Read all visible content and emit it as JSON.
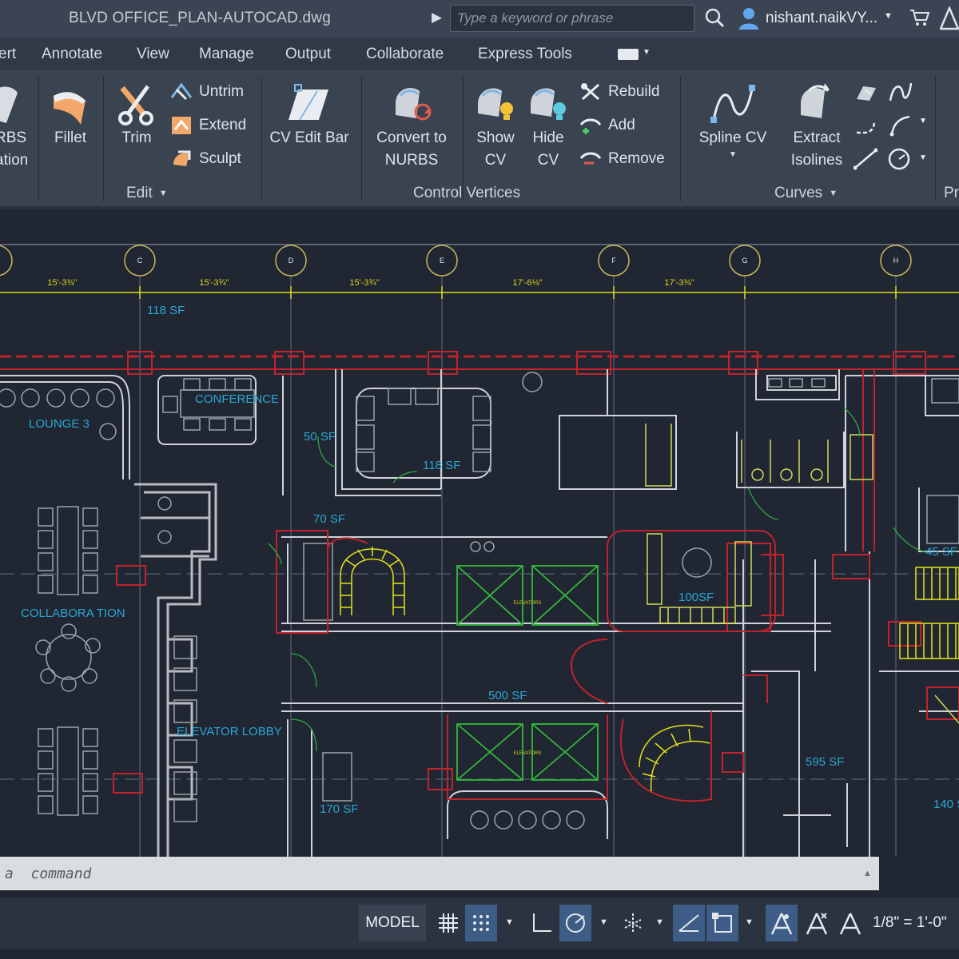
{
  "titlebar": {
    "document_title": "BLVD OFFICE_PLAN-AUTOCAD.dwg",
    "search_placeholder": "Type a keyword or phrase",
    "username": "nishant.naikVY..."
  },
  "ribbon_tabs": [
    "ert",
    "Annotate",
    "View",
    "Manage",
    "Output",
    "Collaborate",
    "Express Tools"
  ],
  "ribbon": {
    "partial_left": {
      "line1": "RBS",
      "line2": "ation"
    },
    "fillet": "Fillet",
    "trim": "Trim",
    "untrim": "Untrim",
    "extend": "Extend",
    "sculpt": "Sculpt",
    "cv_edit_bar": "CV Edit Bar",
    "convert_line1": "Convert to",
    "convert_line2": "NURBS",
    "show_line1": "Show",
    "show_line2": "CV",
    "hide_line1": "Hide",
    "hide_line2": "CV",
    "rebuild": "Rebuild",
    "add": "Add",
    "remove": "Remove",
    "spline_cv": "Spline CV",
    "extract_line1": "Extract",
    "extract_line2": "Isolines",
    "partial_right": "Pr",
    "panels": {
      "edit": "Edit",
      "control_vertices": "Control Vertices",
      "curves": "Curves"
    }
  },
  "drawing": {
    "grid_bubbles": [
      "C",
      "D",
      "E",
      "F",
      "G",
      "H"
    ],
    "dimensions": [
      "15'-3⅜\"",
      "15'-3¾\"",
      "15'-3¾\"",
      "17'-6⅛\"",
      "17'-3⅜\""
    ],
    "rooms": {
      "r118_top": "118 SF",
      "lounge": "LOUNGE 3",
      "conference": "CONFERENCE",
      "r50": "50 SF",
      "r118_mid": "118 SF",
      "r70": "70 SF",
      "collaboration": "COLLABORA TION",
      "r100": "100SF",
      "r45": "45 SF",
      "r500": "500 SF",
      "elevator_lobby": "ELEVATOR LOBBY",
      "r170": "170 SF",
      "r595": "595 SF",
      "r140": "140 S"
    },
    "elevator_label": "ELEVATORS"
  },
  "command_line": {
    "placeholder": "a  command"
  },
  "statusbar": {
    "model": "MODEL",
    "scale": "1/8\" = 1'-0\""
  },
  "colors": {
    "accent_blue": "#3d5d86",
    "grid_blue": "#2aa7d6",
    "wall_red": "#c0232b",
    "dim_yellow": "#d7d71b",
    "elevator_green": "#34b93a"
  }
}
